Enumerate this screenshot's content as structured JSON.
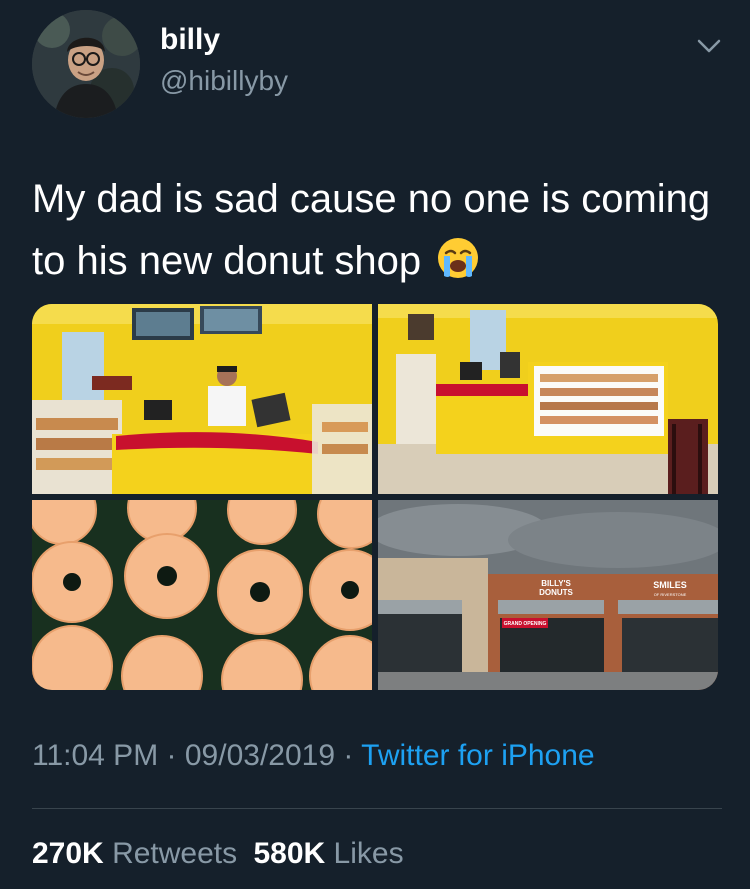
{
  "author": {
    "name": "billy",
    "handle": "@hibillyby"
  },
  "tweet": {
    "text": "My dad is sad cause no one is coming to his new donut shop",
    "emoji": "loudly-crying-face"
  },
  "media": {
    "sign_shop": "BILLY'S",
    "sign_shop_sub": "DONUTS",
    "sign_neighbor": "SMILES",
    "sign_neighbor_sub": "OF RIVERSTONE",
    "banner": "GRAND OPENING"
  },
  "meta": {
    "time": "11:04 PM",
    "separator": "·",
    "date": "09/03/2019",
    "source": "Twitter for iPhone"
  },
  "stats": {
    "retweets_count": "270K",
    "retweets_label": "Retweets",
    "likes_count": "580K",
    "likes_label": "Likes"
  },
  "colors": {
    "background": "#15202b",
    "link": "#1da1f2",
    "secondary_text": "#8899a6",
    "shop_yellow": "#f2d21e",
    "counter_red": "#c8102e"
  },
  "icons": [
    "chevron-down-icon",
    "loudly-crying-face-emoji"
  ]
}
